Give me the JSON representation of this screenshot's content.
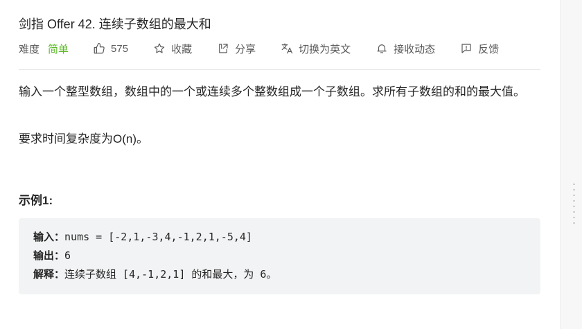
{
  "problem": {
    "title": "剑指 Offer 42. 连续子数组的最大和",
    "difficulty_label": "难度",
    "difficulty": "简单",
    "likes": "575",
    "actions": {
      "favorite": "收藏",
      "share": "分享",
      "switch_lang": "切换为英文",
      "subscribe": "接收动态",
      "feedback": "反馈"
    },
    "colors": {
      "easy": "#5ab726",
      "code_bg": "#f2f3f4"
    }
  },
  "content": {
    "description": "输入一个整型数组，数组中的一个或连续多个整数组成一个子数组。求所有子数组的和的最大值。",
    "requirement": "要求时间复杂度为O(n)。",
    "example_title": "示例1:",
    "example": {
      "input_label": "输入：",
      "input": "nums = [-2,1,-3,4,-1,2,1,-5,4]",
      "output_label": "输出：",
      "output": "6",
      "explain_label": "解释：",
      "explain": "连续子数组 [4,-1,2,1] 的和最大，为 6。"
    }
  },
  "icons": [
    "thumbs-up-icon",
    "star-icon",
    "share-icon",
    "translate-icon",
    "bell-icon",
    "feedback-icon"
  ]
}
